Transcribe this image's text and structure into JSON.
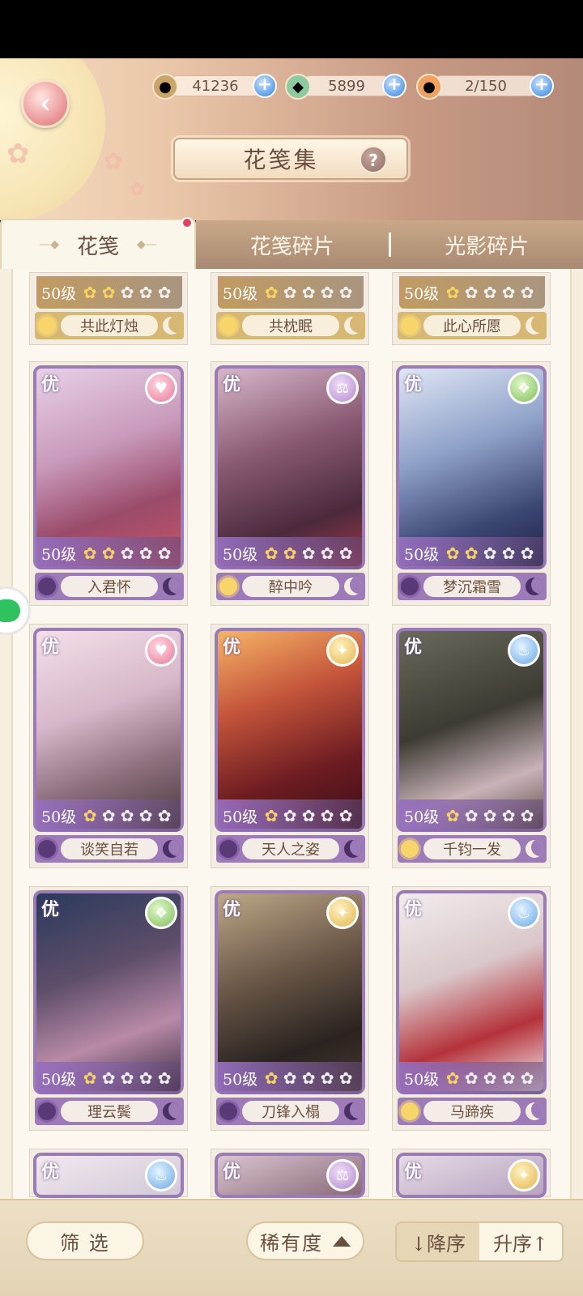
{
  "header": {
    "title": "花笺集",
    "currencies": [
      {
        "icon": "paw-coin-icon",
        "value": "41236"
      },
      {
        "icon": "jade-icon",
        "value": "5899"
      },
      {
        "icon": "stamina-cake-icon",
        "value": "2/150"
      }
    ]
  },
  "tabs": [
    {
      "label": "花笺",
      "active": true
    },
    {
      "label": "花笺碎片",
      "active": false
    },
    {
      "label": "光影碎片",
      "active": false
    }
  ],
  "cards": [
    {
      "name": "共此灯烛",
      "level": "50级",
      "stars": 2,
      "rarity": "",
      "badge": "",
      "sun": "light",
      "partial": true
    },
    {
      "name": "共枕眠",
      "level": "50级",
      "stars": 1,
      "rarity": "",
      "badge": "",
      "sun": "light",
      "partial": true
    },
    {
      "name": "此心所愿",
      "level": "50级",
      "stars": 1,
      "rarity": "",
      "badge": "",
      "sun": "light",
      "partial": true
    },
    {
      "name": "入君怀",
      "level": "50级",
      "stars": 2,
      "rarity": "优",
      "badge": "heart-icon",
      "sun": "dark"
    },
    {
      "name": "醉中吟",
      "level": "50级",
      "stars": 2,
      "rarity": "优",
      "badge": "scale-icon",
      "sun": "light"
    },
    {
      "name": "梦沉霜雪",
      "level": "50级",
      "stars": 2,
      "rarity": "优",
      "badge": "leaf-icon",
      "sun": "dark"
    },
    {
      "name": "谈笑自若",
      "level": "50级",
      "stars": 1,
      "rarity": "优",
      "badge": "heart-icon",
      "sun": "dark"
    },
    {
      "name": "天人之姿",
      "level": "50级",
      "stars": 1,
      "rarity": "优",
      "badge": "bird-icon",
      "sun": "dark"
    },
    {
      "name": "千钧一发",
      "level": "50级",
      "stars": 1,
      "rarity": "优",
      "badge": "flame-icon",
      "sun": "light"
    },
    {
      "name": "理云鬓",
      "level": "50级",
      "stars": 1,
      "rarity": "优",
      "badge": "leaf-icon",
      "sun": "dark"
    },
    {
      "name": "刀锋入榻",
      "level": "50级",
      "stars": 1,
      "rarity": "优",
      "badge": "bird-icon",
      "sun": "dark"
    },
    {
      "name": "马蹄疾",
      "level": "50级",
      "stars": 1,
      "rarity": "优",
      "badge": "flame-icon",
      "sun": "light"
    },
    {
      "rarity": "优",
      "badge": "flame-icon",
      "peek": true
    },
    {
      "rarity": "优",
      "badge": "scale-icon",
      "peek": true
    },
    {
      "rarity": "优",
      "badge": "bird-icon",
      "peek": true
    }
  ],
  "bottom": {
    "filter_label": "筛 选",
    "sort_field_label": "稀有度",
    "desc_label": "↓降序",
    "asc_label": "升序↑"
  }
}
